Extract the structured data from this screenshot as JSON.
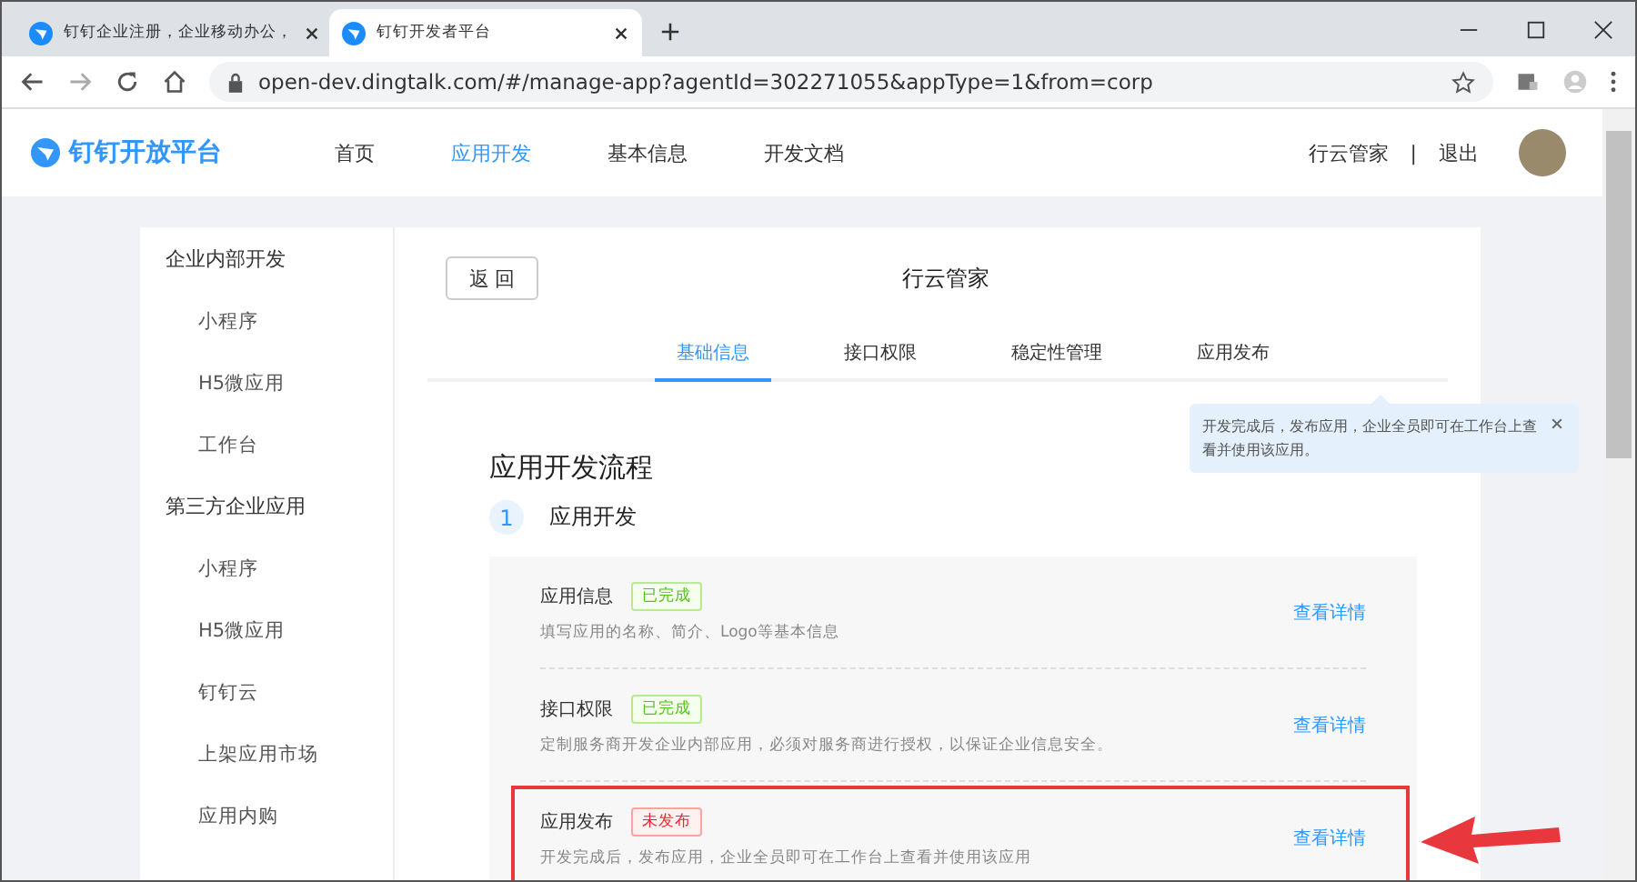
{
  "browser": {
    "tabs": [
      {
        "title": "钉钉企业注册，企业移动办公，",
        "selected": false
      },
      {
        "title": "钉钉开发者平台",
        "selected": true
      }
    ],
    "url": "open-dev.dingtalk.com/#/manage-app?agentId=302271055&appType=1&from=corp"
  },
  "header": {
    "logo": "钉钉开放平台",
    "nav": [
      {
        "label": "首页",
        "selected": false
      },
      {
        "label": "应用开发",
        "selected": true
      },
      {
        "label": "基本信息",
        "selected": false
      },
      {
        "label": "开发文档",
        "selected": false
      }
    ],
    "user": "行云管家",
    "separator": "|",
    "logout": "退出"
  },
  "sidebar": {
    "groups": [
      {
        "title": "企业内部开发",
        "items": [
          "小程序",
          "H5微应用",
          "工作台"
        ]
      },
      {
        "title": "第三方企业应用",
        "items": [
          "小程序",
          "H5微应用",
          "钉钉云",
          "上架应用市场",
          "应用内购"
        ]
      }
    ]
  },
  "main": {
    "back_button": "返 回",
    "app_name": "行云管家",
    "tabs": [
      {
        "label": "基础信息",
        "selected": true
      },
      {
        "label": "接口权限",
        "selected": false
      },
      {
        "label": "稳定性管理",
        "selected": false
      },
      {
        "label": "应用发布",
        "selected": false
      }
    ],
    "tooltip": "开发完成后，发布应用，企业全员即可在工作台上查看并使用该应用。",
    "heading": "应用开发流程",
    "step": {
      "number": "1",
      "title": "应用开发"
    },
    "items": [
      {
        "title": "应用信息",
        "kind": "done",
        "badge": "已完成",
        "description": "填写应用的名称、简介、Logo等基本信息",
        "link": "查看详情",
        "highlighted": false
      },
      {
        "title": "接口权限",
        "kind": "done",
        "badge": "已完成",
        "description": "定制服务商开发企业内部应用，必须对服务商进行授权，以保证企业信息安全。",
        "link": "查看详情",
        "highlighted": false
      },
      {
        "title": "应用发布",
        "kind": "pending",
        "badge": "未发布",
        "description": "开发完成后，发布应用，企业全员即可在工作台上查看并使用该应用",
        "link": "查看详情",
        "highlighted": true
      }
    ]
  }
}
